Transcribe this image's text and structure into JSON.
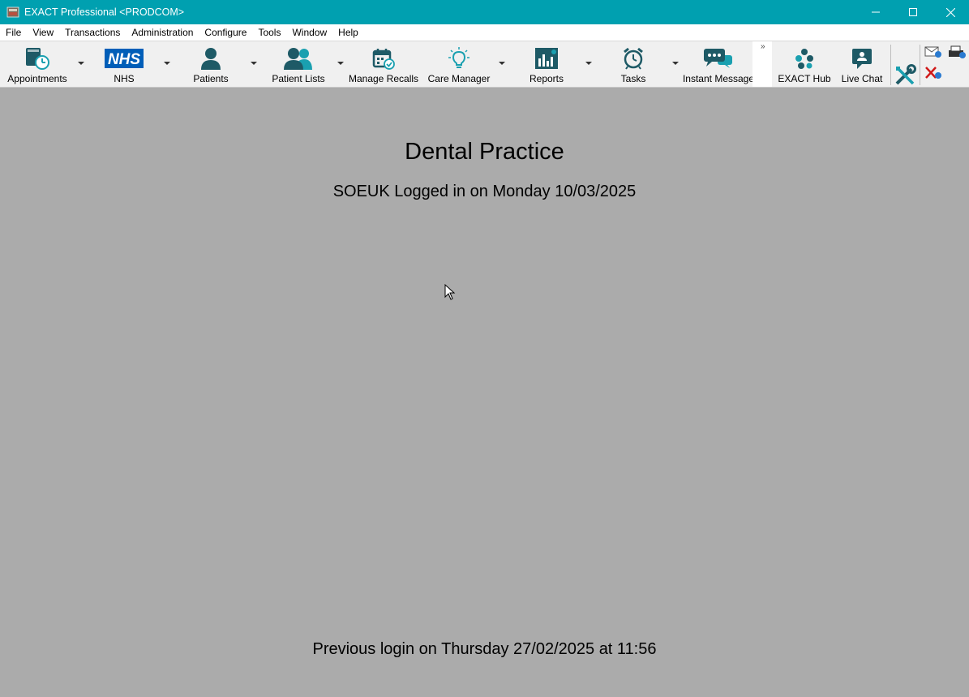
{
  "window": {
    "title": "EXACT Professional <PRODCOM>",
    "controls": [
      "minimize-icon",
      "maximize-icon",
      "close-icon"
    ],
    "accent_color": "#00a0b0"
  },
  "menu": [
    "File",
    "View",
    "Transactions",
    "Administration",
    "Configure",
    "Tools",
    "Window",
    "Help"
  ],
  "toolbar": {
    "buttons": [
      {
        "label": "Appointments",
        "icon": "appointments-icon",
        "dropdown": true
      },
      {
        "label": "NHS",
        "icon": "nhs-logo-icon",
        "dropdown": true
      },
      {
        "label": "Patients",
        "icon": "patient-icon",
        "dropdown": true
      },
      {
        "label": "Patient Lists",
        "icon": "patient-lists-icon",
        "dropdown": true
      },
      {
        "label": "Manage Recalls",
        "icon": "calendar-check-icon",
        "dropdown": false
      },
      {
        "label": "Care Manager",
        "icon": "lightbulb-icon",
        "dropdown": true
      },
      {
        "label": "Reports",
        "icon": "reports-chart-icon",
        "dropdown": true
      },
      {
        "label": "Tasks",
        "icon": "alarm-clock-icon",
        "dropdown": true
      },
      {
        "label": "Instant Message",
        "icon": "chat-bubbles-icon",
        "dropdown": false
      },
      {
        "label": "EXACT Hub",
        "icon": "hub-network-icon",
        "dropdown": false
      },
      {
        "label": "Live Chat",
        "icon": "live-chat-icon",
        "dropdown": false
      }
    ],
    "overflow_chevron": "»",
    "extra_icons": [
      "tools-wrench-icon",
      "mail-icon",
      "printer-icon",
      "close-red-icon"
    ]
  },
  "main": {
    "practice_name": "Dental Practice",
    "login_text": "SOEUK Logged in on Monday 10/03/2025",
    "previous_login_text": "Previous login on Thursday 27/02/2025 at 11:56",
    "background_color": "#ababab"
  }
}
